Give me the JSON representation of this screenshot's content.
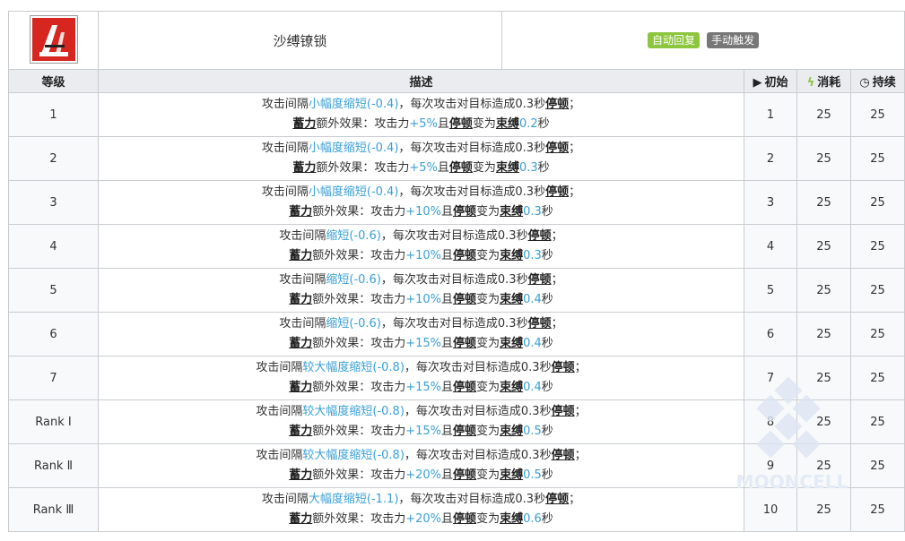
{
  "skill": {
    "name": "沙缚镣锁",
    "icon": "skill-icon-red",
    "badges": [
      {
        "label": "自动回复",
        "color": "#8cc63e"
      },
      {
        "label": "手动触发",
        "color": "#777777"
      }
    ]
  },
  "columns": {
    "level": "等级",
    "description": "描述",
    "initial": "初始",
    "cost": "消耗",
    "duration": "持续"
  },
  "text": {
    "prefix": "攻击间隔",
    "mid": "，每次攻击对目标造成0.3秒",
    "stun": "停顿",
    "end1": "；",
    "charge": "蓄力",
    "extra": "额外效果：攻击力",
    "and": "且",
    "becomes": "变为",
    "bind": "束缚",
    "sec": "秒"
  },
  "rows": [
    {
      "level": "1",
      "interval": "小幅度缩短(-0.4)",
      "atk": "+5%",
      "bind_time": "0.2",
      "initial": "1",
      "cost": "25",
      "duration": "25"
    },
    {
      "level": "2",
      "interval": "小幅度缩短(-0.4)",
      "atk": "+5%",
      "bind_time": "0.3",
      "initial": "2",
      "cost": "25",
      "duration": "25"
    },
    {
      "level": "3",
      "interval": "小幅度缩短(-0.4)",
      "atk": "+10%",
      "bind_time": "0.3",
      "initial": "3",
      "cost": "25",
      "duration": "25"
    },
    {
      "level": "4",
      "interval": "缩短(-0.6)",
      "atk": "+10%",
      "bind_time": "0.3",
      "initial": "4",
      "cost": "25",
      "duration": "25"
    },
    {
      "level": "5",
      "interval": "缩短(-0.6)",
      "atk": "+10%",
      "bind_time": "0.4",
      "initial": "5",
      "cost": "25",
      "duration": "25"
    },
    {
      "level": "6",
      "interval": "缩短(-0.6)",
      "atk": "+15%",
      "bind_time": "0.4",
      "initial": "6",
      "cost": "25",
      "duration": "25"
    },
    {
      "level": "7",
      "interval": "较大幅度缩短(-0.8)",
      "atk": "+15%",
      "bind_time": "0.4",
      "initial": "7",
      "cost": "25",
      "duration": "25"
    },
    {
      "level": "Rank Ⅰ",
      "interval": "较大幅度缩短(-0.8)",
      "atk": "+15%",
      "bind_time": "0.5",
      "initial": "8",
      "cost": "25",
      "duration": "25"
    },
    {
      "level": "Rank Ⅱ",
      "interval": "较大幅度缩短(-0.8)",
      "atk": "+20%",
      "bind_time": "0.5",
      "initial": "9",
      "cost": "25",
      "duration": "25"
    },
    {
      "level": "Rank Ⅲ",
      "interval": "大幅度缩短(-1.1)",
      "atk": "+20%",
      "bind_time": "0.6",
      "initial": "10",
      "cost": "25",
      "duration": "25"
    }
  ],
  "watermark": "MOONCELL"
}
